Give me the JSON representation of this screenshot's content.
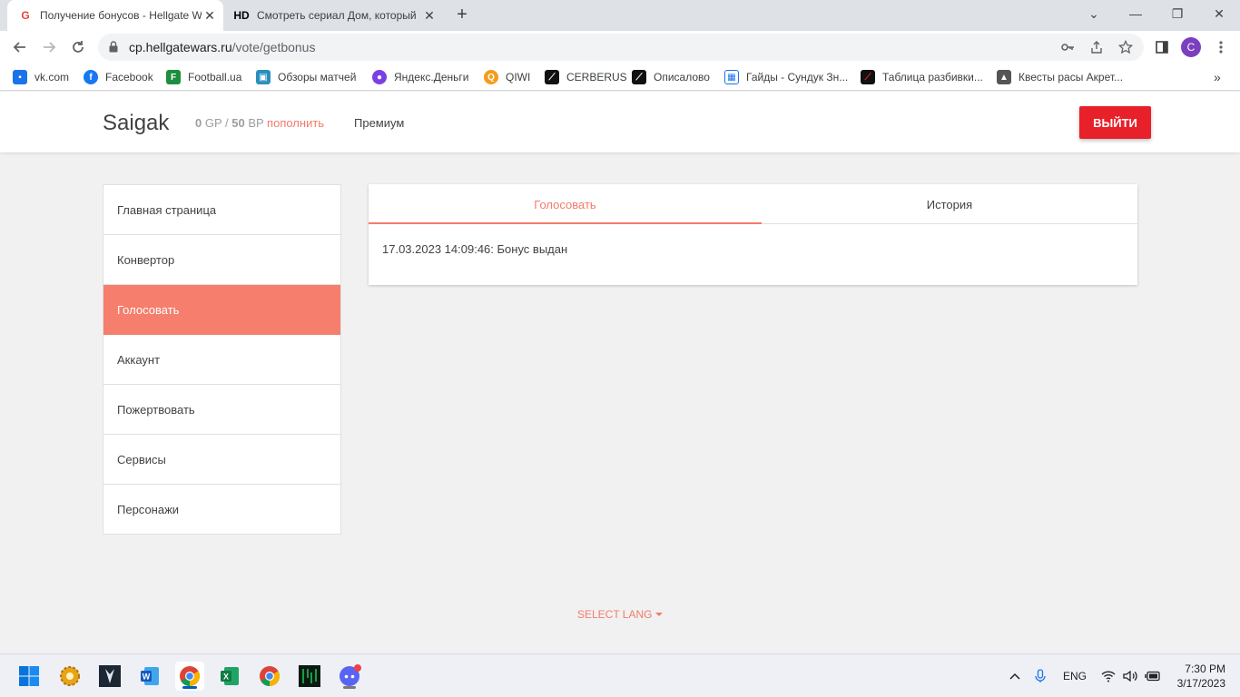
{
  "browser": {
    "tabs": [
      {
        "title": "Получение бонусов - Hellgate W",
        "favicon": "G",
        "active": true
      },
      {
        "title": "Смотреть сериал Дом, который",
        "favicon": "HD",
        "active": false
      }
    ],
    "url_host": "cp.hellgatewars.ru",
    "url_path": "/vote/getbonus",
    "profile_initial": "C",
    "bookmarks": [
      {
        "label": "vk.com",
        "color": "#1a73e8",
        "glyph": "▪"
      },
      {
        "label": "Facebook",
        "color": "#1877f2",
        "glyph": "f"
      },
      {
        "label": "Football.ua",
        "color": "#1e8e3e",
        "glyph": "F"
      },
      {
        "label": "Обзоры матчей",
        "color": "#2a8fbd",
        "glyph": "▣"
      },
      {
        "label": "Яндекс.Деньги",
        "color": "#7b3fe4",
        "glyph": "●"
      },
      {
        "label": "QIWI",
        "color": "#f59c1a",
        "glyph": "Q"
      },
      {
        "label": "CERBERUS",
        "color": "#111111",
        "glyph": "⟋"
      },
      {
        "label": "Описалово",
        "color": "#111111",
        "glyph": "⟋"
      },
      {
        "label": "Гайды - Сундук Зн...",
        "color": "#1a73e8",
        "glyph": "▦"
      },
      {
        "label": "Таблица разбивки...",
        "color": "#111111",
        "glyph": "⟋"
      },
      {
        "label": "Квесты расы Акрет...",
        "color": "#555555",
        "glyph": "▲"
      }
    ],
    "more_bookmarks": "»"
  },
  "site": {
    "username": "Saigak",
    "gp_amount": "0",
    "gp_label": " GP / ",
    "bp_amount": "50",
    "bp_label": " BP ",
    "topup": "пополнить",
    "premium": "Премиум",
    "logout": "ВЫЙТИ"
  },
  "sidebar": {
    "items": [
      {
        "label": "Главная страница"
      },
      {
        "label": "Конвертор"
      },
      {
        "label": "Голосовать"
      },
      {
        "label": "Аккаунт"
      },
      {
        "label": "Пожертвовать"
      },
      {
        "label": "Сервисы"
      },
      {
        "label": "Персонажи"
      }
    ],
    "active_index": 2
  },
  "main": {
    "tabs": [
      {
        "label": "Голосовать",
        "active": true
      },
      {
        "label": "История",
        "active": false
      }
    ],
    "log_entry": "17.03.2023 14:09:46: Бонус выдан"
  },
  "footer": {
    "select_lang": "SELECT LANG"
  },
  "taskbar": {
    "lang": "ENG",
    "time": "7:30 PM",
    "date": "3/17/2023"
  },
  "colors": {
    "accent": "#f47b6b",
    "logout_red": "#e8202a"
  }
}
